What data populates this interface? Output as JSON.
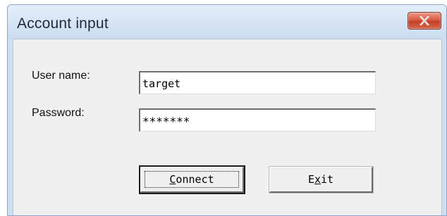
{
  "window": {
    "title": "Account input",
    "close_icon": "close-icon"
  },
  "form": {
    "username_label": "User name:",
    "username_value": "target",
    "password_label": "Password:",
    "password_value": "*******"
  },
  "buttons": {
    "connect": {
      "mnemonic": "C",
      "rest": "onnect"
    },
    "exit": {
      "prefix": "E",
      "mnemonic": "x",
      "rest": "it"
    }
  },
  "colors": {
    "titlebar": "#cfe0f2",
    "client": "#f0f0f0",
    "close_button": "#c84b34"
  }
}
